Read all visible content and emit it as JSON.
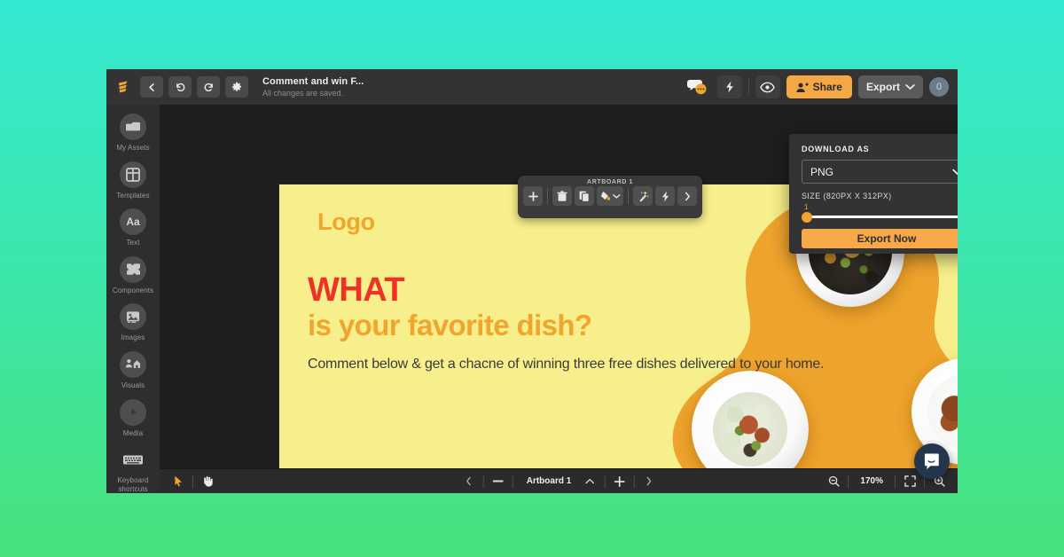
{
  "header": {
    "logo_icon": "swipe-logo-icon",
    "back_icon": "chevron-left-icon",
    "undo_icon": "undo-icon",
    "redo_icon": "redo-icon",
    "settings_icon": "gear-icon",
    "doc_title": "Comment and win F...",
    "doc_status": "All changes are saved.",
    "comments_icon": "comments-bubble-icon",
    "flash_icon": "lightning-icon",
    "preview_icon": "eye-icon",
    "share_label": "Share",
    "share_icon": "user-plus-icon",
    "export_label": "Export",
    "export_chevron_icon": "chevron-down-icon",
    "user_count": "0"
  },
  "sidebar": {
    "items": [
      {
        "label": "My Assets",
        "icon": "folder-icon"
      },
      {
        "label": "Templates",
        "icon": "grid-template-icon"
      },
      {
        "label": "Text",
        "icon": "text-aa-icon"
      },
      {
        "label": "Components",
        "icon": "puzzle-icon"
      },
      {
        "label": "Images",
        "icon": "image-icon"
      },
      {
        "label": "Visuals",
        "icon": "visuals-icon"
      },
      {
        "label": "Media",
        "icon": "play-circle-icon"
      },
      {
        "label": "Keyboard shortcuts",
        "icon": "keyboard-icon"
      }
    ]
  },
  "artboard_toolbar": {
    "title": "ARTBOARD 1",
    "buttons": [
      {
        "name": "add-artboard",
        "icon": "plus-icon"
      },
      {
        "name": "delete-artboard",
        "icon": "trash-icon"
      },
      {
        "name": "duplicate-artboard",
        "icon": "copy-icon"
      },
      {
        "name": "fill-color",
        "icon": "paint-bucket-icon"
      },
      {
        "name": "fill-color-chevron",
        "icon": "chevron-down-icon"
      },
      {
        "name": "magic-effects",
        "icon": "magic-wand-icon"
      },
      {
        "name": "animate",
        "icon": "lightning-icon"
      },
      {
        "name": "more-options",
        "icon": "chevron-right-icon"
      }
    ]
  },
  "design": {
    "logo": "Logo",
    "headline_line1": "WHAT",
    "headline_line2": "is your favorite dish?",
    "body": "Comment below & get a chacne of winning three free dishes delivered to your home.",
    "bg_color": "#F7EF8B",
    "blob_color": "#EDA32C",
    "headline1_color": "#F03226",
    "headline2_color": "#F0A52E",
    "plates": [
      {
        "name": "plate-top-black-rice"
      },
      {
        "name": "plate-left-tuna-salad"
      },
      {
        "name": "plate-right-grilled-steak"
      }
    ]
  },
  "export_panel": {
    "download_as_label": "DOWNLOAD AS",
    "format_value": "PNG",
    "format_chevron_icon": "chevron-down-icon",
    "size_label": "SIZE (820PX X 312PX)",
    "slider_value": "1",
    "export_now_label": "Export Now"
  },
  "statusbar": {
    "select_tool_icon": "cursor-arrow-icon",
    "hand_tool_icon": "hand-icon",
    "prev_artboard_icon": "chevron-left-icon",
    "minus_icon": "minus-icon",
    "artboard_name": "Artboard 1",
    "caret_up_icon": "chevron-up-icon",
    "plus_icon": "plus-icon",
    "next_artboard_icon": "chevron-right-icon",
    "zoom_out_icon": "zoom-out-icon",
    "zoom_level": "170%",
    "fit_screen_icon": "fit-screen-icon",
    "zoom_in_icon": "zoom-in-icon"
  },
  "intercom": {
    "icon": "chat-smile-icon"
  }
}
